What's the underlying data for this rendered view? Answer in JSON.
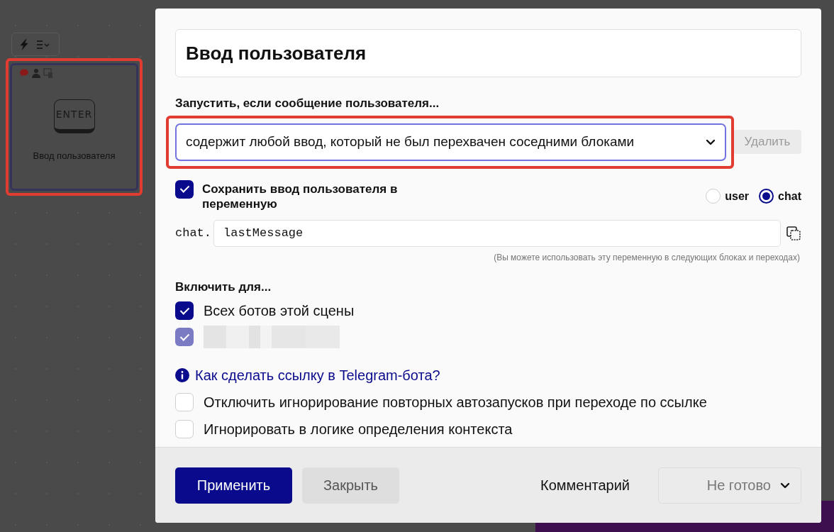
{
  "canvas": {
    "node": {
      "key_label": "ENTER",
      "title": "Ввод пользователя",
      "highlighted": true
    }
  },
  "dialog": {
    "title_field": {
      "value": "Ввод пользователя"
    },
    "trigger_label": "Запустить, если сообщение пользователя...",
    "trigger_select": {
      "value": "содержит любой ввод, который не был перехвачен соседними блоками",
      "highlighted": true
    },
    "delete_button": {
      "label": "Удалить",
      "disabled": true
    },
    "save_variable": {
      "label": "Сохранить ввод пользователя в переменную",
      "checked": true
    },
    "scope_options": [
      {
        "label": "user",
        "selected": false
      },
      {
        "label": "chat",
        "selected": true
      }
    ],
    "variable_prefix": "chat.",
    "variable_field": {
      "value": "lastMessage"
    },
    "variable_hint": "(Вы можете использовать эту переменную в следующих блоках и переходах)",
    "enable_for_label": "Включить для...",
    "enable_for": [
      {
        "label": "Всех ботов этой сцены",
        "checked": true,
        "disabled": false
      },
      {
        "checked": true,
        "disabled": true
      }
    ],
    "help_link": "Как сделать ссылку в Telegram-бота?",
    "options": [
      {
        "label": "Отключить игнорирование повторных автозапусков при переходе по ссылке",
        "checked": false
      },
      {
        "label": "Игнорировать в логике определения контекста",
        "checked": false
      }
    ],
    "footer": {
      "apply_button": "Применить",
      "close_button": "Закрыть",
      "comment_link": "Комментарий",
      "status_select": {
        "value": "Не готово"
      }
    }
  }
}
